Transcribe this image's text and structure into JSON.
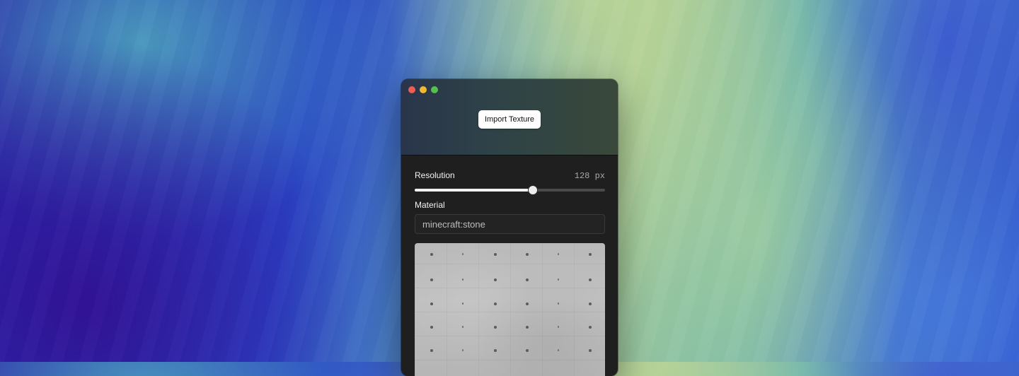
{
  "window": {
    "import_button_label": "Import Texture"
  },
  "resolution": {
    "label": "Resolution",
    "value_text": "128 px",
    "slider_fraction": 0.618
  },
  "material": {
    "label": "Material",
    "value": "minecraft:stone"
  },
  "icons": {
    "close": "close-traffic-light-icon",
    "minimize": "minimize-traffic-light-icon",
    "zoom": "zoom-traffic-light-icon"
  },
  "colors": {
    "close": "#ee5c53",
    "minimize": "#f2b832",
    "zoom": "#55c14a"
  }
}
